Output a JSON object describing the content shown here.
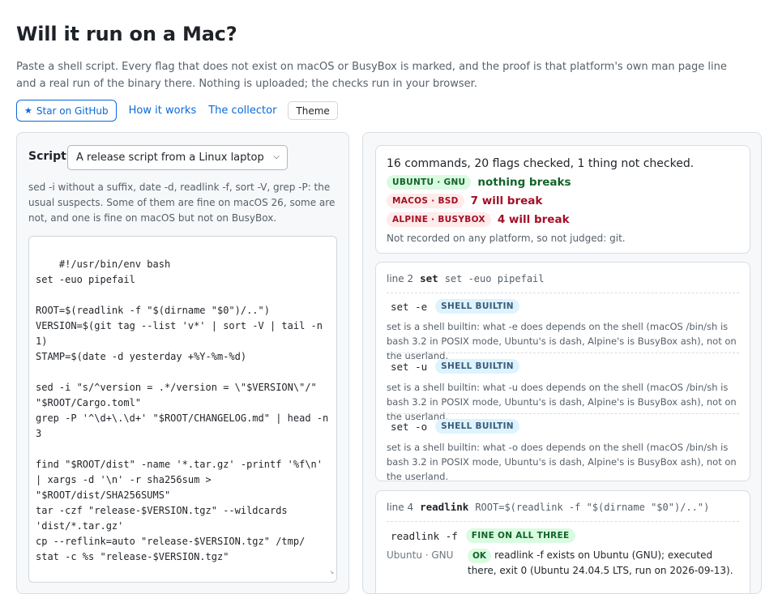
{
  "page": {
    "title": "Will it run on a Mac?",
    "intro": "Paste a shell script. Every flag that does not exist on macOS or BusyBox is marked, and the proof is that platform's own man page line and a real run of the binary there. Nothing is uploaded; the checks run in your browser."
  },
  "toolbar": {
    "star_label": "Star on GitHub",
    "how_label": "How it works",
    "collector_label": "The collector",
    "theme_label": "Theme"
  },
  "script_panel": {
    "label": "Script",
    "selected_example": "A release script from a Linux laptop",
    "note": "sed -i without a suffix, date -d, readlink -f, sort -V, grep -P: the usual suspects. Some of them are fine on macOS 26, some are not, and one is fine on macOS but not on BusyBox.",
    "code": "#!/usr/bin/env bash\nset -euo pipefail\n\nROOT=$(readlink -f \"$(dirname \"$0\")/..\")\nVERSION=$(git tag --list 'v*' | sort -V | tail -n\n1)\nSTAMP=$(date -d yesterday +%Y-%m-%d)\n\nsed -i \"s/^version = .*/version = \\\"$VERSION\\\"/\"\n\"$ROOT/Cargo.toml\"\ngrep -P '^\\d+\\.\\d+' \"$ROOT/CHANGELOG.md\" | head -n\n3\n\nfind \"$ROOT/dist\" -name '*.tar.gz' -printf '%f\\n'\n| xargs -d '\\n' -r sha256sum >\n\"$ROOT/dist/SHA256SUMS\"\ntar -czf \"release-$VERSION.tgz\" --wildcards\n'dist/*.tar.gz'\ncp --reflink=auto \"release-$VERSION.tgz\" /tmp/\nstat -c %s \"release-$VERSION.tgz\""
  },
  "summary": {
    "counts": "16 commands, 20 flags checked, 1 thing not checked.",
    "verdicts": [
      {
        "platform": "UBUNTU · GNU",
        "result": "nothing breaks",
        "status": "ok"
      },
      {
        "platform": "MACOS · BSD",
        "result": "7 will break",
        "status": "bad"
      },
      {
        "platform": "ALPINE · BUSYBOX",
        "result": "4 will break",
        "status": "bad"
      }
    ],
    "not_judged": "Not recorded on any platform, so not judged: git."
  },
  "findings": [
    {
      "line_label": "line 2",
      "command": "set",
      "source": "set -euo pipefail",
      "flags": [
        {
          "flag": "set -e",
          "tag": "SHELL BUILTIN",
          "desc": "set is a shell builtin: what -e does depends on the shell (macOS /bin/sh is bash 3.2 in POSIX mode, Ubuntu's is dash, Alpine's is BusyBox ash), not on the userland."
        },
        {
          "flag": "set -u",
          "tag": "SHELL BUILTIN",
          "desc": "set is a shell builtin: what -u does depends on the shell (macOS /bin/sh is bash 3.2 in POSIX mode, Ubuntu's is dash, Alpine's is BusyBox ash), not on the userland."
        },
        {
          "flag": "set -o",
          "tag": "SHELL BUILTIN",
          "desc": "set is a shell builtin: what -o does depends on the shell (macOS /bin/sh is bash 3.2 in POSIX mode, Ubuntu's is dash, Alpine's is BusyBox ash), not on the userland."
        }
      ]
    },
    {
      "line_label": "line 4",
      "command": "readlink",
      "source": "ROOT=$(readlink -f \"$(dirname \"$0\")/..\")",
      "flag": "readlink -f",
      "tag": "FINE ON ALL THREE",
      "platform": "Ubuntu · GNU",
      "ok": "OK",
      "evidence": "readlink -f exists on Ubuntu (GNU); executed there, exit 0 (Ubuntu 24.04.5 LTS, run on 2026-09-13)."
    }
  ],
  "colors": {
    "accent": "#0969da",
    "ok_green": "#116329",
    "bad_red": "#a40e26",
    "builtin_blue": "#3e5b78"
  }
}
